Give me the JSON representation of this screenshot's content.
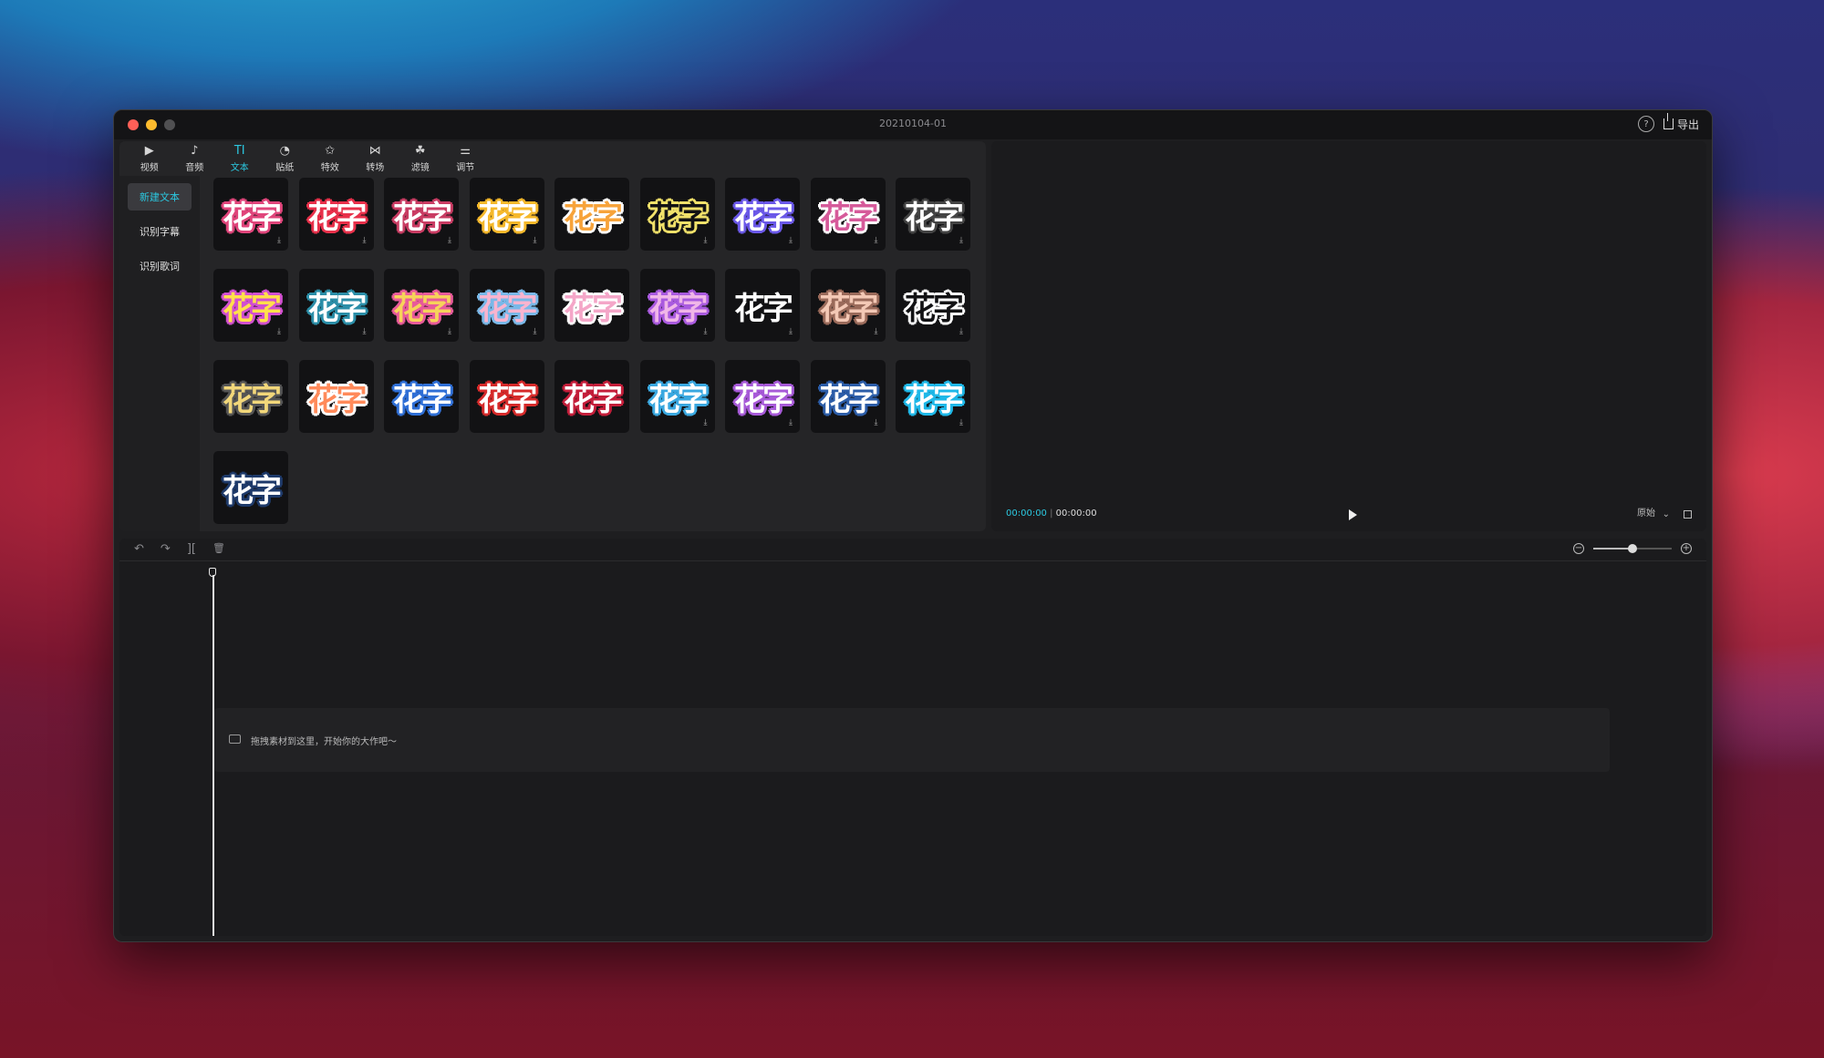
{
  "window": {
    "title": "20210104-01"
  },
  "titlebar": {
    "help_icon": "?",
    "export_label": "导出"
  },
  "toolbar": {
    "tabs": [
      {
        "label": "视频",
        "icon": "▶"
      },
      {
        "label": "音频",
        "icon": "♪"
      },
      {
        "label": "文本",
        "icon": "TI"
      },
      {
        "label": "贴纸",
        "icon": "◔"
      },
      {
        "label": "特效",
        "icon": "✩"
      },
      {
        "label": "转场",
        "icon": "⋈"
      },
      {
        "label": "滤镜",
        "icon": "☘"
      },
      {
        "label": "调节",
        "icon": "⚌"
      }
    ]
  },
  "sidebar": {
    "items": [
      {
        "label": "新建文本",
        "active": true
      },
      {
        "label": "识别字幕",
        "active": false
      },
      {
        "label": "识别歌词",
        "active": false
      }
    ]
  },
  "library": {
    "tile_text": "花字",
    "download_icon": "⤓",
    "tiles": [
      {
        "fill": "#ffffff",
        "stroke": "#e0457b",
        "dl": true
      },
      {
        "fill": "#ffffff",
        "stroke": "#e8304a",
        "dl": true
      },
      {
        "fill": "#ffffff",
        "stroke": "#c93c63",
        "dl": true
      },
      {
        "fill": "#ffffff",
        "stroke": "#f5b82b",
        "dl": true
      },
      {
        "fill": "#f7a33a",
        "stroke": "#ffffff",
        "dl": false
      },
      {
        "fill": "#121214",
        "stroke": "#f1e16a",
        "dl": true
      },
      {
        "fill": "#ffffff",
        "stroke": "#6a58e8",
        "dl": true
      },
      {
        "fill": "#d65a9a",
        "stroke": "#ffffff",
        "dl": true
      },
      {
        "fill": "#ffffff",
        "stroke": "#444444",
        "dl": true
      },
      {
        "fill": "#ffe04a",
        "stroke": "#d14fd0",
        "dl": true
      },
      {
        "fill": "#ffffff",
        "stroke": "#2b8ea8",
        "dl": true
      },
      {
        "fill": "#f6d35a",
        "stroke": "#e85a9a",
        "dl": true
      },
      {
        "fill": "#f9b4cf",
        "stroke": "#79b8e8",
        "dl": true
      },
      {
        "fill": "#f4a6c8",
        "stroke": "#ffffff",
        "dl": false
      },
      {
        "fill": "#f0b6e8",
        "stroke": "#a95adf",
        "dl": true
      },
      {
        "fill": "#ffffff",
        "stroke": "#121214",
        "dl": true
      },
      {
        "fill": "#f3c8b5",
        "stroke": "#9a6a5a",
        "dl": true
      },
      {
        "fill": "#121214",
        "stroke": "#ffffff",
        "dl": true
      },
      {
        "fill": "#f2d77a",
        "stroke": "#555555",
        "dl": false
      },
      {
        "fill": "#ff8a5a",
        "stroke": "#ffffff",
        "dl": false
      },
      {
        "fill": "#ffffff",
        "stroke": "#2f6fd6",
        "dl": false
      },
      {
        "fill": "#ffffff",
        "stroke": "#d62a2a",
        "dl": false
      },
      {
        "fill": "#ffffff",
        "stroke": "#c41e3a",
        "dl": false
      },
      {
        "fill": "#ffffff",
        "stroke": "#3aa8e0",
        "dl": true
      },
      {
        "fill": "#ffffff",
        "stroke": "#a75ad8",
        "dl": true
      },
      {
        "fill": "#ffffff",
        "stroke": "#2c5da8",
        "dl": true
      },
      {
        "fill": "#ffffff",
        "stroke": "#1fb8e8",
        "dl": true
      },
      {
        "fill": "#ffffff",
        "stroke": "#1e3a6a",
        "dl": false
      }
    ]
  },
  "player": {
    "current_time": "00:00:00",
    "total_time": "00:00:00",
    "ratio_label": "原始",
    "ratio_chevron": "⌄"
  },
  "timeline": {
    "tools": [
      "↶",
      "↷",
      "][",
      "🗑"
    ],
    "zoom_out": "−",
    "zoom_in": "+",
    "zoom_level": 0.5,
    "drop_hint": "拖拽素材到这里，开始你的大作吧～"
  },
  "colors": {
    "accent": "#2bc8e0",
    "window_bg": "#1e1e20",
    "panel_bg": "#252527"
  }
}
